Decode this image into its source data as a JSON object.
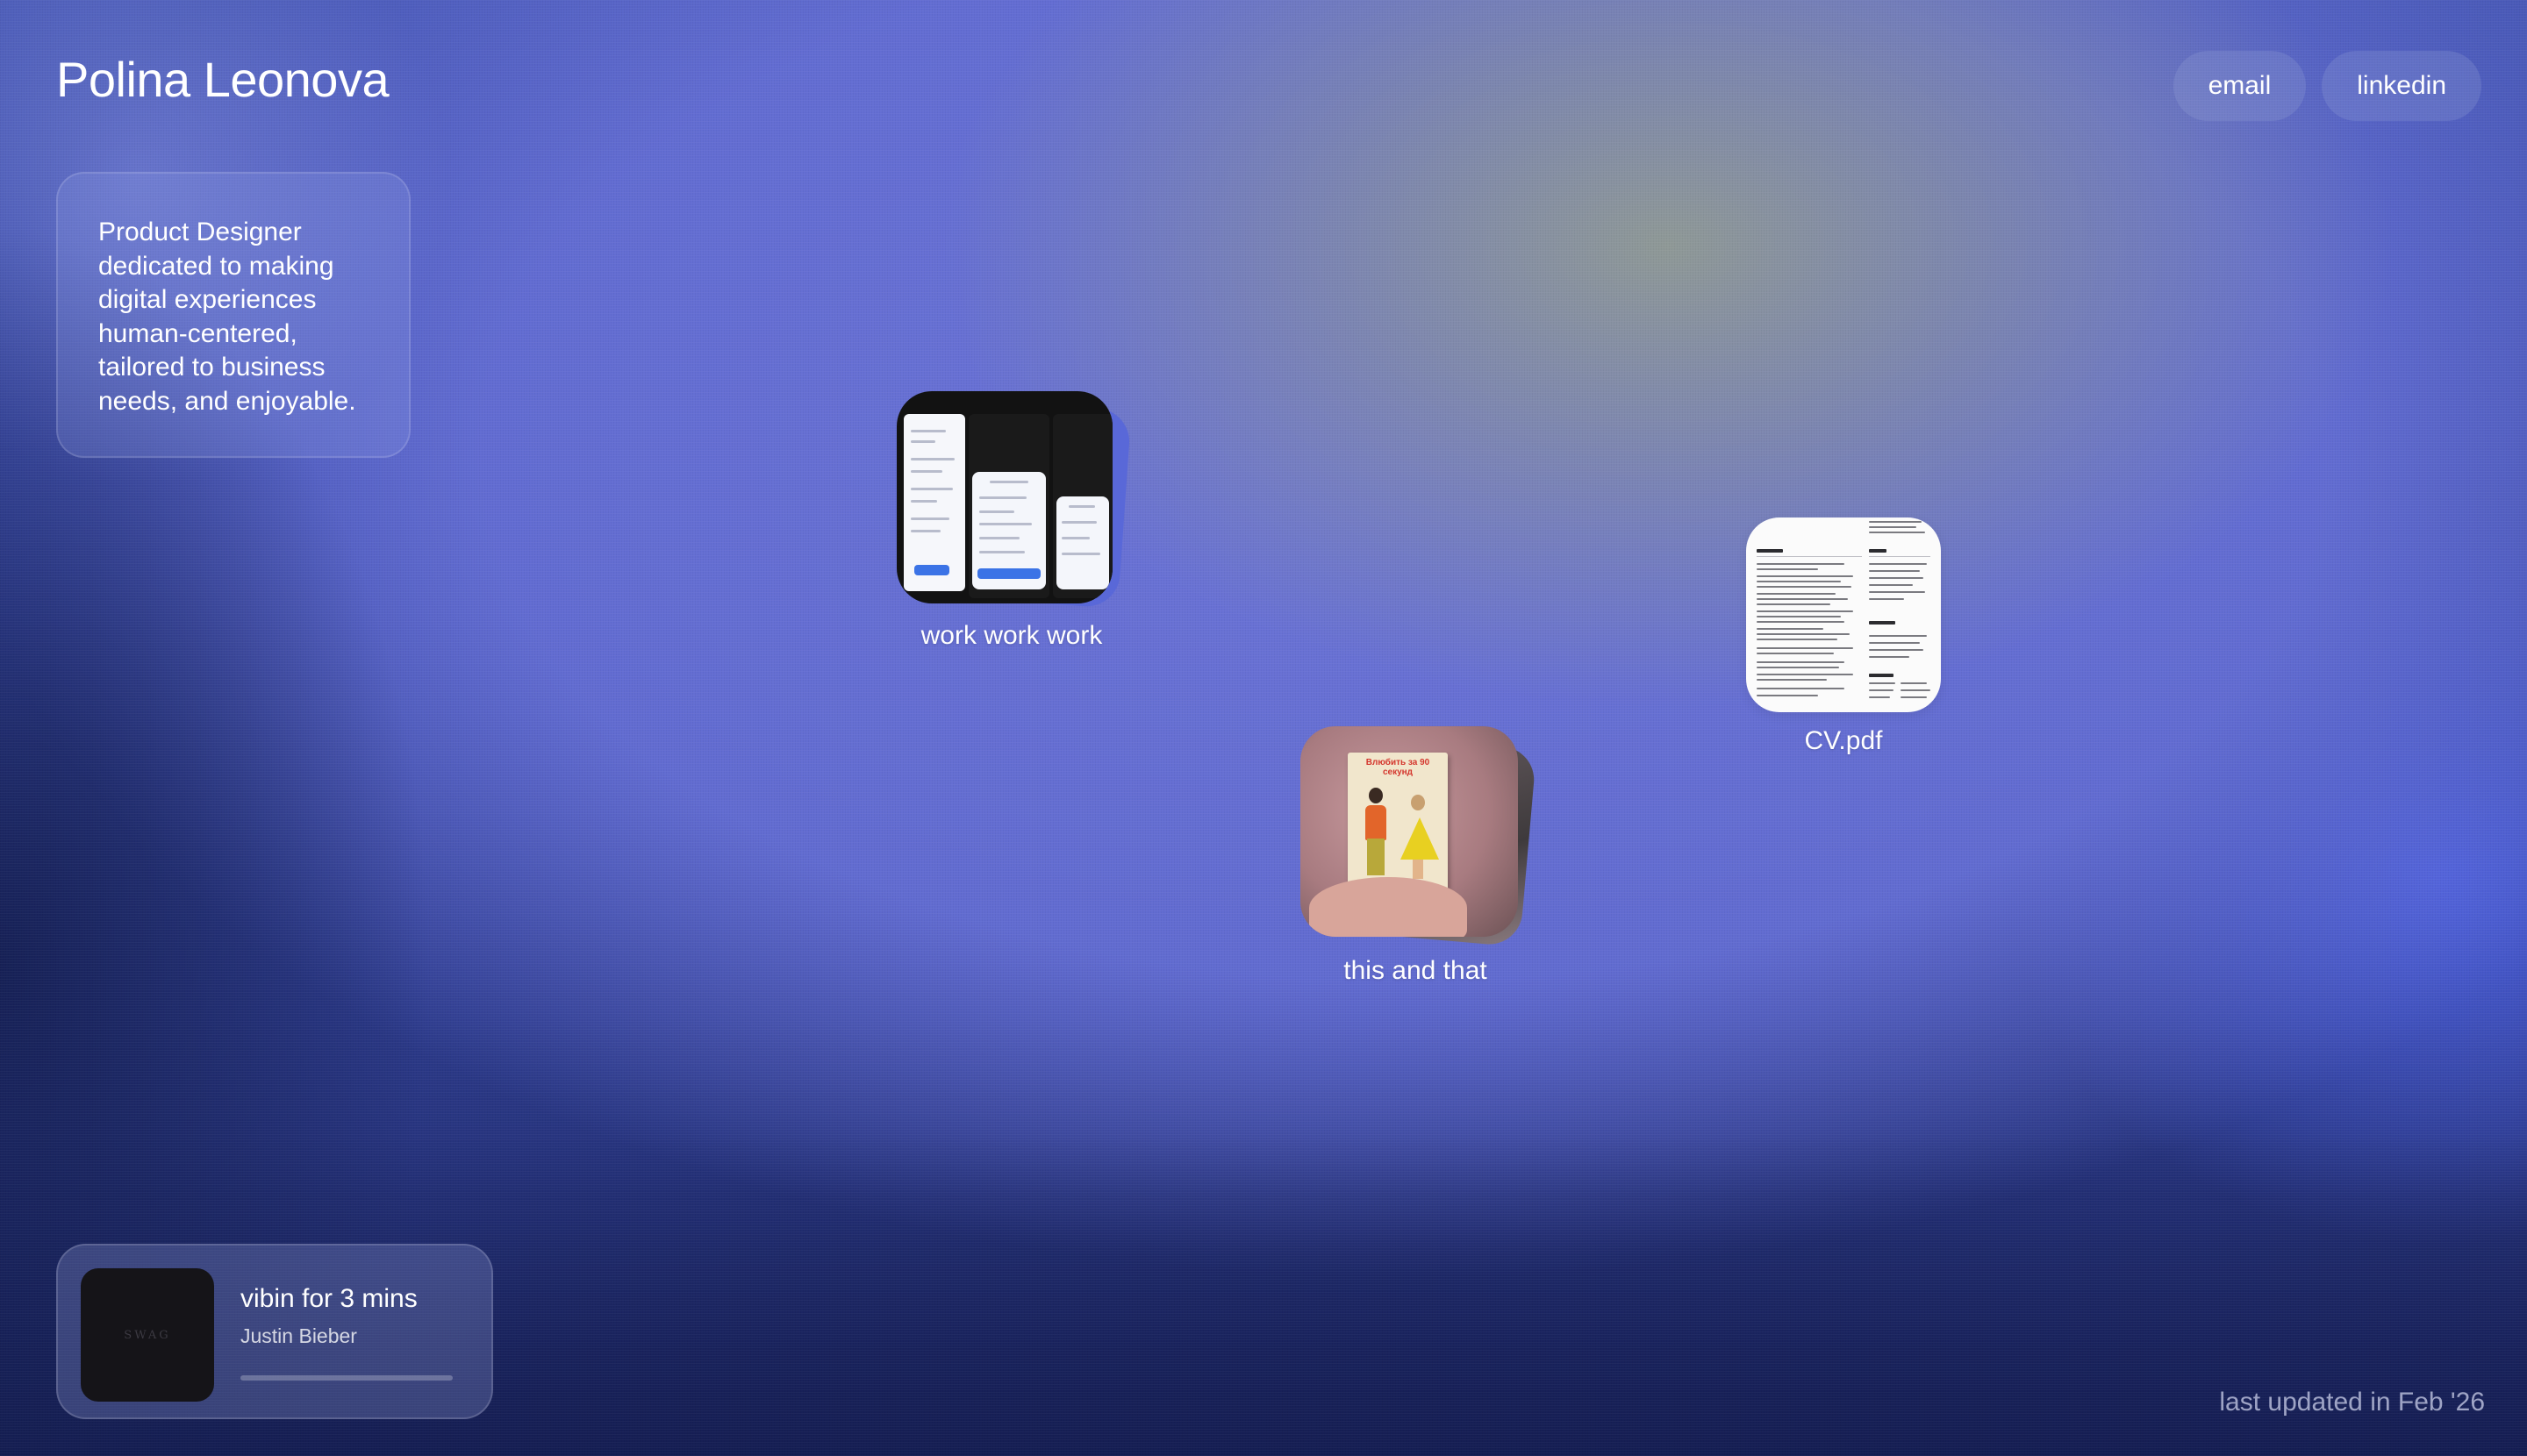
{
  "header": {
    "site_title": "Polina Leonova",
    "nav": [
      {
        "label": "email"
      },
      {
        "label": "linkedin"
      }
    ]
  },
  "bio": {
    "text": "Product Designer dedicated to making digital experiences human-centered, tailored to business needs, and enjoyable."
  },
  "desktop_items": [
    {
      "label": "work work work",
      "icon": "app-screens-thumbnail"
    },
    {
      "label": "CV.pdf",
      "icon": "pdf-document-thumbnail"
    },
    {
      "label": "this and that",
      "icon": "photo-thumbnail"
    }
  ],
  "book_cover": {
    "title": "Влюбить за 90 секунд"
  },
  "now_playing": {
    "album_text": "SWAG",
    "title": "vibin for 3 mins",
    "artist": "Justin Bieber",
    "progress": 0
  },
  "footer": {
    "updated": "last updated in Feb '26"
  },
  "colors": {
    "accent_blue": "#5968d8",
    "text": "#ffffff"
  }
}
